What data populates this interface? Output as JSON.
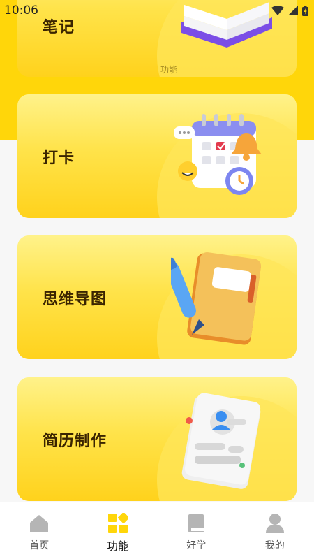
{
  "status_bar": {
    "time": "10:06"
  },
  "cards": {
    "notes": {
      "label": "笔记",
      "subtitle": "功能"
    },
    "checkin": {
      "label": "打卡"
    },
    "mindmap": {
      "label": "思维导图"
    },
    "resume": {
      "label": "简历制作"
    }
  },
  "tabbar": {
    "items": [
      {
        "label": "首页",
        "icon": "home-icon",
        "active": false
      },
      {
        "label": "功能",
        "icon": "grid-icon",
        "active": true
      },
      {
        "label": "好学",
        "icon": "book-icon",
        "active": false
      },
      {
        "label": "我的",
        "icon": "user-icon",
        "active": false
      }
    ]
  },
  "colors": {
    "accent": "#ffd60a",
    "label": "#3a2400",
    "tab_inactive": "#b5b5b5"
  }
}
